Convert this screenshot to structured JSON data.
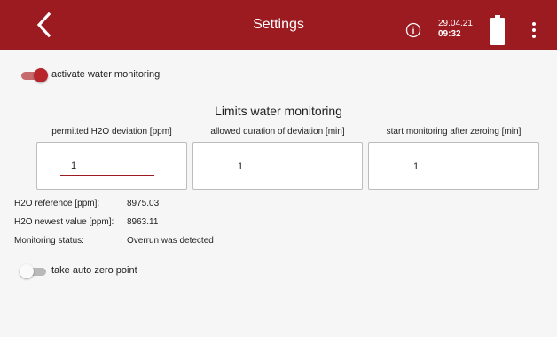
{
  "header": {
    "title": "Settings",
    "date": "29.04.21",
    "time": "09:32",
    "back_icon": "chevron-left-icon",
    "info_icon": "info-circle-icon",
    "battery_icon": "battery-full-icon",
    "more_icon": "more-vertical-icon",
    "color": "#9c1b21"
  },
  "water_toggle": {
    "label": "activate water monitoring",
    "checked": true
  },
  "limits": {
    "title": "Limits water monitoring",
    "fields": [
      {
        "label": "permitted H2O deviation [ppm]",
        "value": "1"
      },
      {
        "label": "allowed duration of deviation [min]",
        "value": "1"
      },
      {
        "label": "start monitoring after zeroing [min]",
        "value": "1"
      }
    ]
  },
  "info": {
    "reference_label": "H2O reference [ppm]:",
    "reference_value": "8975.03",
    "newest_label": "H2O newest value [ppm]:",
    "newest_value": "8963.11",
    "status_label": "Monitoring status:",
    "status_value": "Overrun was detected"
  },
  "auto_zero_toggle": {
    "label": "take auto zero point",
    "checked": false
  }
}
